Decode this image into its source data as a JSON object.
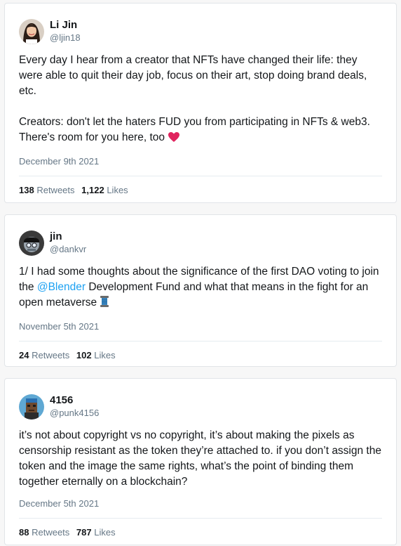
{
  "tweets": [
    {
      "display_name": "Li Jin",
      "handle": "@ljin18",
      "text": "Every day I hear from a creator that NFTs have changed their life: they were able to quit their day job, focus on their art, stop doing brand deals, etc.\n\nCreators: don't let the haters FUD you from participating in NFTs & web3. There's room for you here, too",
      "date": "December 9th 2021",
      "retweets": "138",
      "retweets_label": "Retweets",
      "likes": "1,122",
      "likes_label": "Likes",
      "emoji": "heart-emoji"
    },
    {
      "display_name": "jin",
      "handle": "@dankvr",
      "text_before": "1/  I had some thoughts about the significance of the first DAO voting to join the ",
      "mention": "@Blender",
      "text_after": " Development Fund and what that means in the fight for an open metaverse ",
      "date": "November 5th 2021",
      "retweets": "24",
      "retweets_label": "Retweets",
      "likes": "102",
      "likes_label": "Likes",
      "emoji": "thread-spool-emoji"
    },
    {
      "display_name": "4156",
      "handle": "@punk4156",
      "text": "it’s not about copyright vs no copyright, it’s about making the pixels as censorship resistant as the token they’re attached to. if you don’t assign the token and the image the same rights, what’s the point of binding them together eternally on a blockchain?",
      "date": "December 5th 2021",
      "retweets": "88",
      "retweets_label": "Retweets",
      "likes": "787",
      "likes_label": "Likes"
    }
  ],
  "colors": {
    "link": "#1da1f2",
    "muted": "#657786",
    "text": "#14171a",
    "heart": "#e0245e"
  }
}
